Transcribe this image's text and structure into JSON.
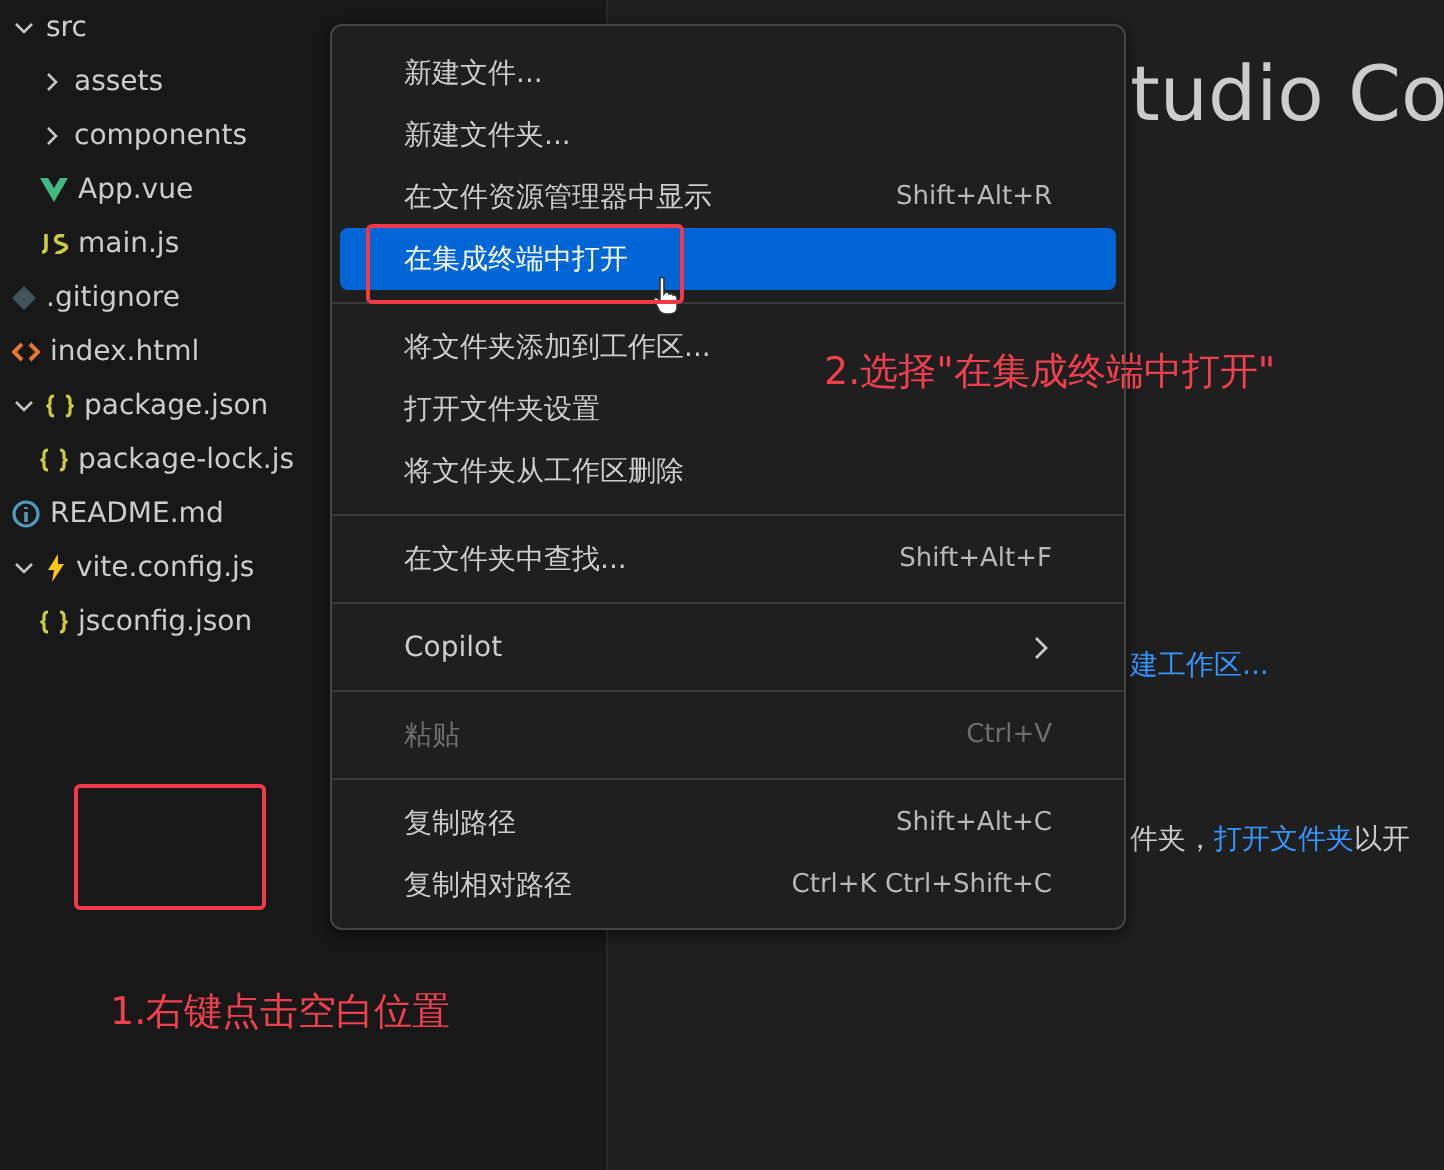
{
  "explorer": {
    "items": [
      {
        "label": "src",
        "kind": "folder",
        "expanded": true,
        "children": [
          {
            "label": "assets",
            "kind": "folder",
            "expanded": false
          },
          {
            "label": "components",
            "kind": "folder",
            "expanded": false
          },
          {
            "label": "App.vue",
            "kind": "vue"
          },
          {
            "label": "main.js",
            "kind": "js"
          }
        ]
      },
      {
        "label": ".gitignore",
        "kind": "git"
      },
      {
        "label": "index.html",
        "kind": "html"
      },
      {
        "label": "package.json",
        "kind": "json",
        "expanded": true,
        "children": [
          {
            "label": "package-lock.js",
            "kind": "json"
          }
        ]
      },
      {
        "label": "README.md",
        "kind": "info"
      },
      {
        "label": "vite.config.js",
        "kind": "vite",
        "expanded": true,
        "children": [
          {
            "label": "jsconfig.json",
            "kind": "json"
          }
        ]
      }
    ]
  },
  "editor": {
    "title": "tudio Co",
    "link": "建工作区...",
    "text": "件夹，",
    "text_link": "打开文件夹",
    "text_end": "以开"
  },
  "context_menu": {
    "groups": [
      [
        {
          "label": "新建文件...",
          "selected": false,
          "disabled": false
        },
        {
          "label": "新建文件夹...",
          "selected": false,
          "disabled": false
        },
        {
          "label": "在文件资源管理器中显示",
          "shortcut": "Shift+Alt+R",
          "selected": false,
          "disabled": false
        },
        {
          "label": "在集成终端中打开",
          "selected": true,
          "disabled": false
        }
      ],
      [
        {
          "label": "将文件夹添加到工作区...",
          "selected": false,
          "disabled": false
        },
        {
          "label": "打开文件夹设置",
          "selected": false,
          "disabled": false
        },
        {
          "label": "将文件夹从工作区删除",
          "selected": false,
          "disabled": false
        }
      ],
      [
        {
          "label": "在文件夹中查找...",
          "shortcut": "Shift+Alt+F",
          "selected": false,
          "disabled": false
        }
      ],
      [
        {
          "label": "Copilot",
          "submenu": true,
          "selected": false,
          "disabled": false
        }
      ],
      [
        {
          "label": "粘贴",
          "shortcut": "Ctrl+V",
          "selected": false,
          "disabled": true
        }
      ],
      [
        {
          "label": "复制路径",
          "shortcut": "Shift+Alt+C",
          "selected": false,
          "disabled": false
        },
        {
          "label": "复制相对路径",
          "shortcut": "Ctrl+K Ctrl+Shift+C",
          "selected": false,
          "disabled": false
        }
      ]
    ]
  },
  "annotations": [
    {
      "text": "2.选择\"在集成终端中打开\""
    },
    {
      "text": "1.右键点击空白位置"
    }
  ]
}
